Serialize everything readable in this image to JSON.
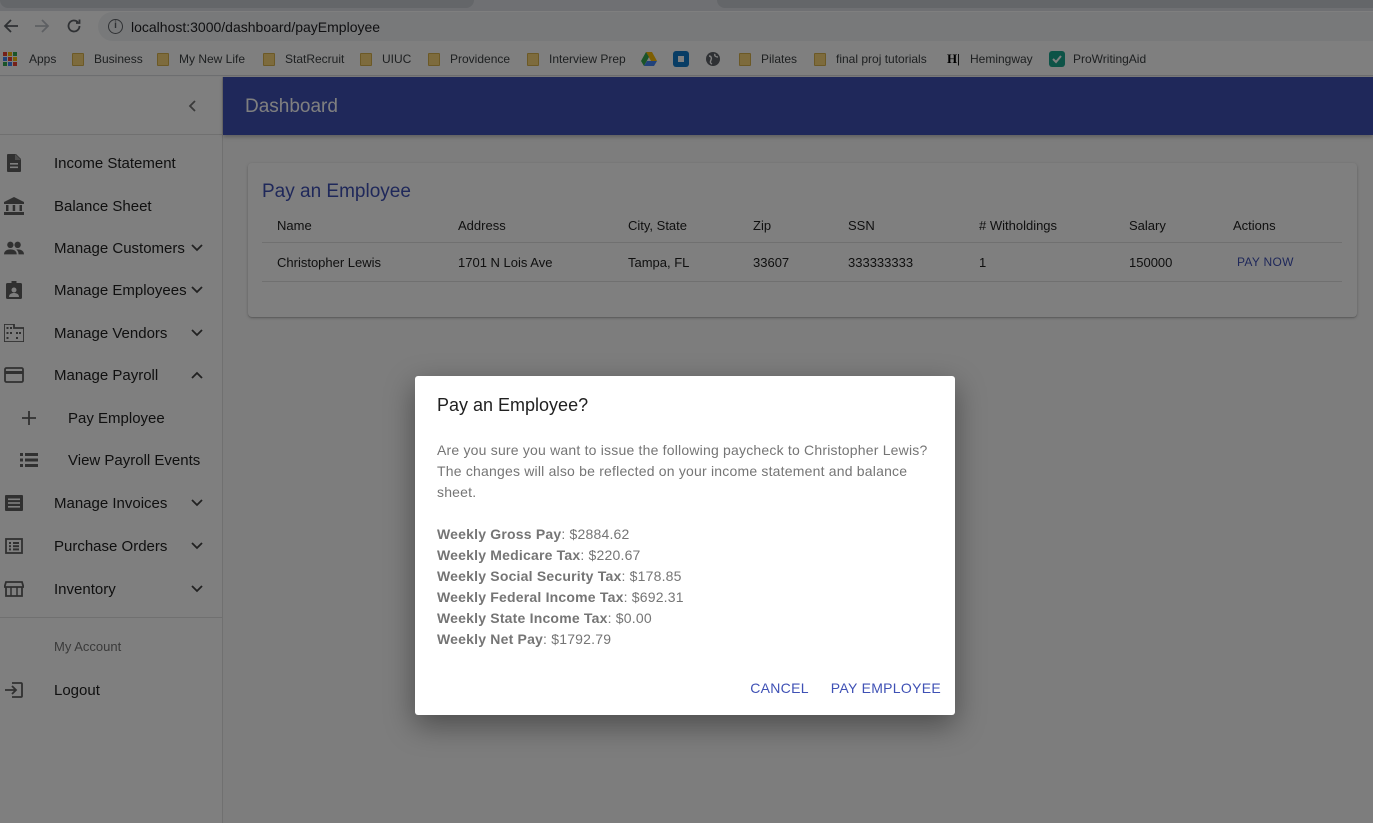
{
  "browser": {
    "url": "localhost:3000/dashboard/payEmployee",
    "bookmarks": [
      "Apps",
      "Business",
      "My New Life",
      "StatRecruit",
      "UIUC",
      "Providence",
      "Interview Prep",
      "Pilates",
      "final proj tutorials",
      "Hemingway",
      "ProWritingAid"
    ]
  },
  "appbar": {
    "title": "Dashboard"
  },
  "sidebar": {
    "items": [
      {
        "label": "Income Statement",
        "icon": "document-icon"
      },
      {
        "label": "Balance Sheet",
        "icon": "bank-icon"
      },
      {
        "label": "Manage Customers",
        "icon": "people-icon"
      },
      {
        "label": "Manage Employees",
        "icon": "badge-icon"
      },
      {
        "label": "Manage Vendors",
        "icon": "building-icon"
      },
      {
        "label": "Manage Payroll",
        "icon": "credit-card-icon"
      },
      {
        "label": "Pay Employee",
        "icon": "plus-icon"
      },
      {
        "label": "View Payroll Events",
        "icon": "list-icon"
      },
      {
        "label": "Manage Invoices",
        "icon": "receipt-icon"
      },
      {
        "label": "Purchase Orders",
        "icon": "list-alt-icon"
      },
      {
        "label": "Inventory",
        "icon": "store-icon"
      }
    ],
    "account_header": "My Account",
    "logout": "Logout"
  },
  "card": {
    "title": "Pay an Employee",
    "columns": [
      "Name",
      "Address",
      "City, State",
      "Zip",
      "SSN",
      "# Witholdings",
      "Salary",
      "Actions"
    ],
    "rows": [
      {
        "name": "Christopher Lewis",
        "address": "1701 N Lois Ave",
        "city_state": "Tampa, FL",
        "zip": "33607",
        "ssn": "333333333",
        "witholdings": "1",
        "salary": "150000",
        "action": "PAY NOW"
      }
    ]
  },
  "dialog": {
    "title": "Pay an Employee?",
    "message": "Are you sure you want to issue the following paycheck to Christopher Lewis? The changes will also be reflected on your income statement and balance sheet.",
    "figures": [
      {
        "label": "Weekly Gross Pay",
        "value": ": $2884.62"
      },
      {
        "label": "Weekly Medicare Tax",
        "value": ": $220.67"
      },
      {
        "label": "Weekly Social Security Tax",
        "value": ": $178.85"
      },
      {
        "label": "Weekly Federal Income Tax",
        "value": ": $692.31"
      },
      {
        "label": "Weekly State Income Tax",
        "value": ": $0.00"
      },
      {
        "label": "Weekly Net Pay",
        "value": ": $1792.79"
      }
    ],
    "cancel_label": "CANCEL",
    "confirm_label": "PAY EMPLOYEE"
  },
  "colors": {
    "primary": "#3f51b5",
    "overlay": "rgba(0,0,0,0.5)"
  }
}
